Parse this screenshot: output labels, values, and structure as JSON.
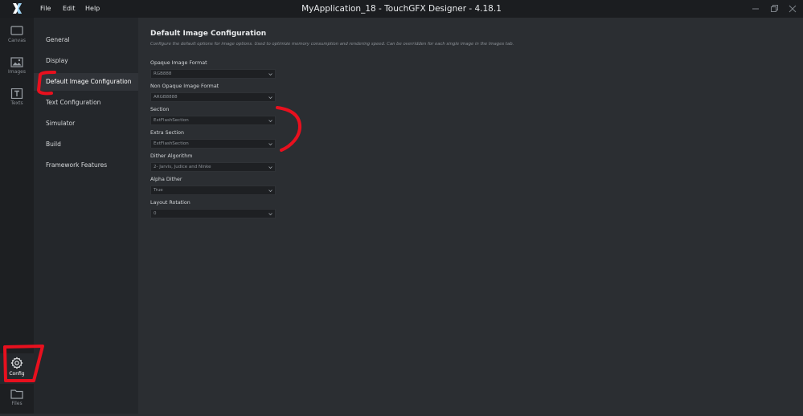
{
  "app": {
    "window_title": "MyApplication_18 - TouchGFX Designer - 4.18.1",
    "menu": [
      "File",
      "Edit",
      "Help"
    ]
  },
  "rail": {
    "items": [
      {
        "label": "Canvas",
        "icon": "canvas-icon"
      },
      {
        "label": "Images",
        "icon": "images-icon"
      },
      {
        "label": "Texts",
        "icon": "texts-icon"
      },
      {
        "label": "Config",
        "icon": "gear-icon",
        "active": true
      },
      {
        "label": "Files",
        "icon": "folder-icon"
      }
    ]
  },
  "categories": [
    {
      "label": "General"
    },
    {
      "label": "Display"
    },
    {
      "label": "Default Image Configuration",
      "active": true
    },
    {
      "label": "Text Configuration"
    },
    {
      "label": "Simulator"
    },
    {
      "label": "Build"
    },
    {
      "label": "Framework Features"
    }
  ],
  "content": {
    "title": "Default Image Configuration",
    "description": "Configure the default options for image options. Used to optimize memory consumption and rendering speed. Can be overridden for each single image in the Images tab.",
    "fields": [
      {
        "label": "Opaque Image Format",
        "value": "RGB888"
      },
      {
        "label": "Non Opaque Image Format",
        "value": "ARGB8888"
      },
      {
        "label": "Section",
        "value": "ExtFlashSection"
      },
      {
        "label": "Extra Section",
        "value": "ExtFlashSection"
      },
      {
        "label": "Dither Algorithm",
        "value": "2- Jarvis, Judice and Ninke"
      },
      {
        "label": "Alpha Dither",
        "value": "True"
      },
      {
        "label": "Layout Rotation",
        "value": "0"
      }
    ]
  },
  "colors": {
    "annotation_red": "#e8101e",
    "titlebar": "#1b1d20",
    "content_bg": "#2b2e32"
  }
}
